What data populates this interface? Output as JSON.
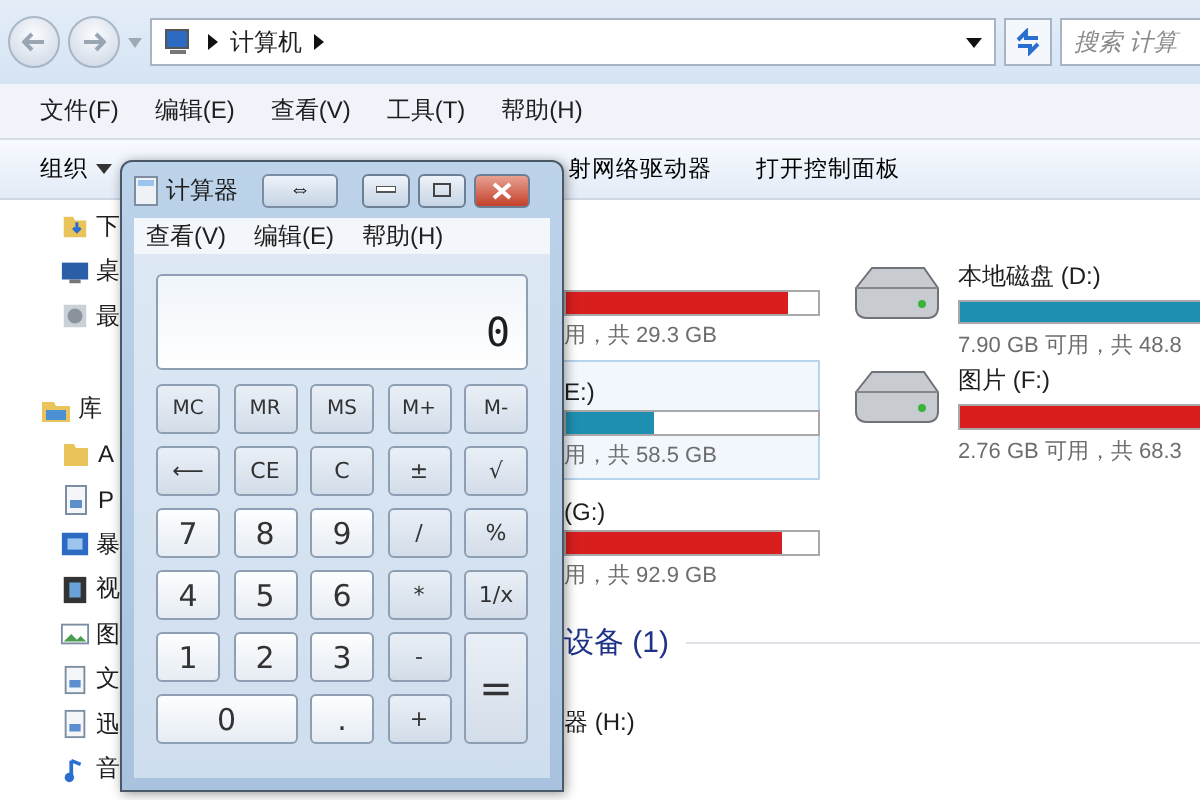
{
  "address": {
    "path": [
      "计算机"
    ]
  },
  "search": {
    "placeholder": "搜索 计算"
  },
  "menu": [
    "文件(F)",
    "编辑(E)",
    "查看(V)",
    "工具(T)",
    "帮助(H)"
  ],
  "toolbar": [
    {
      "label": "组织",
      "dropdown": true
    },
    {
      "label": "射网络驱动器",
      "dropdown": false
    },
    {
      "label": "打开控制面板",
      "dropdown": false
    }
  ],
  "sidebar": [
    {
      "label": "下",
      "kind": "download",
      "group": false
    },
    {
      "label": "桌",
      "kind": "desktop",
      "group": false
    },
    {
      "label": "最",
      "kind": "recent",
      "group": false
    },
    {
      "label": "库",
      "kind": "library",
      "group": true
    },
    {
      "label": "A",
      "kind": "folder",
      "group": false
    },
    {
      "label": "P",
      "kind": "document",
      "group": false
    },
    {
      "label": "暴",
      "kind": "video",
      "group": false
    },
    {
      "label": "视",
      "kind": "film",
      "group": false
    },
    {
      "label": "图",
      "kind": "picture",
      "group": false
    },
    {
      "label": "文",
      "kind": "document",
      "group": false
    },
    {
      "label": "迅",
      "kind": "document",
      "group": false
    },
    {
      "label": "音",
      "kind": "music",
      "group": false
    }
  ],
  "drives_left": [
    {
      "level": 0.88,
      "color": "#d81e1e",
      "info": "用，共 29.3 GB",
      "selected": false
    },
    {
      "name": "E:)",
      "level": 0.35,
      "color": "#1e8fb0",
      "info": "用，共 58.5 GB",
      "selected": true
    },
    {
      "name": "(G:)",
      "level": 0.86,
      "color": "#d81e1e",
      "info": "用，共 92.9 GB",
      "selected": false
    }
  ],
  "drives_right": [
    {
      "name": "本地磁盘 (D:)",
      "level": 1,
      "color": "#1e8fb0",
      "info": "7.90 GB 可用，共 48.8"
    },
    {
      "name": "图片 (F:)",
      "level": 1,
      "color": "#d81e1e",
      "info": "2.76 GB 可用，共 68.3"
    }
  ],
  "devices": {
    "header": "设备 (1)",
    "item": "器 (H:)"
  },
  "calculator": {
    "title": "计算器",
    "mode_button": "⇔",
    "menu": [
      "查看(V)",
      "编辑(E)",
      "帮助(H)"
    ],
    "display": "0",
    "keys": [
      {
        "label": "MC",
        "kind": "memory"
      },
      {
        "label": "MR",
        "kind": "memory"
      },
      {
        "label": "MS",
        "kind": "memory"
      },
      {
        "label": "M+",
        "kind": "memory"
      },
      {
        "label": "M-",
        "kind": "memory"
      },
      {
        "label": "⟵",
        "kind": "op"
      },
      {
        "label": "CE",
        "kind": "op"
      },
      {
        "label": "C",
        "kind": "op"
      },
      {
        "label": "±",
        "kind": "op"
      },
      {
        "label": "√",
        "kind": "op"
      },
      {
        "label": "7",
        "kind": "digit"
      },
      {
        "label": "8",
        "kind": "digit"
      },
      {
        "label": "9",
        "kind": "digit"
      },
      {
        "label": "/",
        "kind": "op"
      },
      {
        "label": "%",
        "kind": "op"
      },
      {
        "label": "4",
        "kind": "digit"
      },
      {
        "label": "5",
        "kind": "digit"
      },
      {
        "label": "6",
        "kind": "digit"
      },
      {
        "label": "*",
        "kind": "op"
      },
      {
        "label": "1/x",
        "kind": "op"
      },
      {
        "label": "1",
        "kind": "digit"
      },
      {
        "label": "2",
        "kind": "digit"
      },
      {
        "label": "3",
        "kind": "digit"
      },
      {
        "label": "-",
        "kind": "op"
      },
      {
        "label": "=",
        "kind": "tall"
      },
      {
        "label": "0",
        "kind": "wide"
      },
      {
        "label": ".",
        "kind": "digit"
      },
      {
        "label": "+",
        "kind": "op"
      }
    ]
  }
}
